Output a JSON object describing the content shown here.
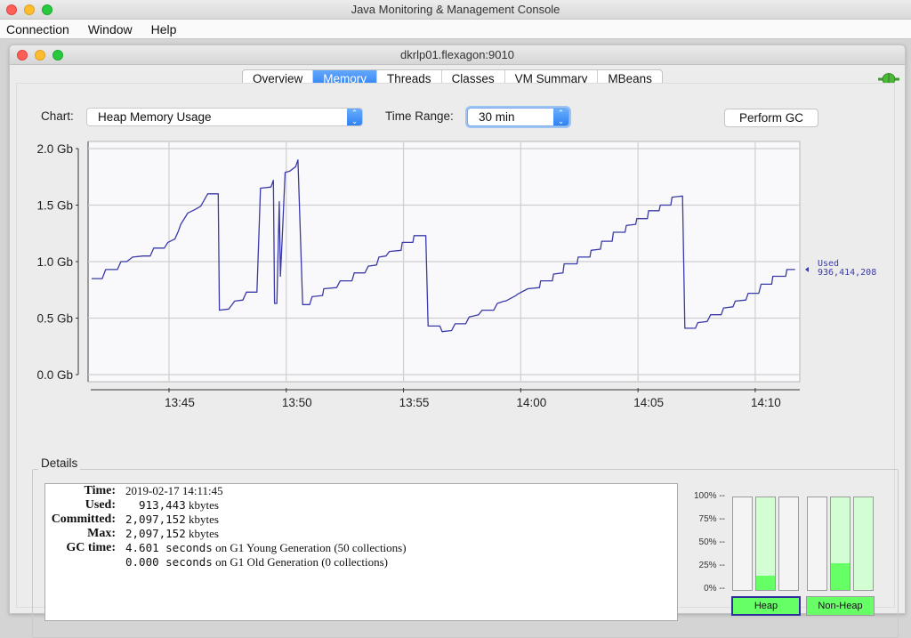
{
  "app": {
    "title": "Java Monitoring & Management Console",
    "menu": [
      "Connection",
      "Window",
      "Help"
    ]
  },
  "window": {
    "title": "dkrlp01.flexagon:9010",
    "tabs": [
      {
        "label": "Overview",
        "active": false
      },
      {
        "label": "Memory",
        "active": true
      },
      {
        "label": "Threads",
        "active": false
      },
      {
        "label": "Classes",
        "active": false
      },
      {
        "label": "VM Summary",
        "active": false
      },
      {
        "label": "MBeans",
        "active": false
      }
    ],
    "connection_icon": "connected-plug-icon"
  },
  "controls": {
    "chart_label": "Chart:",
    "chart_value": "Heap Memory Usage",
    "time_range_label": "Time Range:",
    "time_range_value": "30 min",
    "perform_gc_label": "Perform GC"
  },
  "chart_data": {
    "type": "line",
    "title": "Heap Memory Usage",
    "xlabel": "",
    "ylabel": "",
    "y_unit": "Gb",
    "ylim": [
      0,
      2.0
    ],
    "yticks": [
      {
        "value": 0.0,
        "label": "0.0 Gb"
      },
      {
        "value": 0.5,
        "label": "0.5 Gb"
      },
      {
        "value": 1.0,
        "label": "1.0 Gb"
      },
      {
        "value": 1.5,
        "label": "1.5 Gb"
      },
      {
        "value": 2.0,
        "label": "2.0 Gb"
      }
    ],
    "x_unit": "minutes since 13:00",
    "xlim": [
      41.7,
      71.9
    ],
    "xticks": [
      {
        "value": 45,
        "label": "13:45"
      },
      {
        "value": 50,
        "label": "13:50"
      },
      {
        "value": 55,
        "label": "13:55"
      },
      {
        "value": 60,
        "label": "14:00"
      },
      {
        "value": 65,
        "label": "14:05"
      },
      {
        "value": 70,
        "label": "14:10"
      }
    ],
    "grid": true,
    "line_color": "#3a3aa8",
    "series": [
      {
        "name": "Used",
        "points": [
          [
            41.7,
            0.85
          ],
          [
            42.15,
            0.85
          ],
          [
            42.3,
            0.93
          ],
          [
            42.8,
            0.93
          ],
          [
            42.95,
            1.0
          ],
          [
            43.2,
            1.0
          ],
          [
            43.45,
            1.04
          ],
          [
            43.9,
            1.05
          ],
          [
            44.2,
            1.05
          ],
          [
            44.35,
            1.12
          ],
          [
            44.8,
            1.12
          ],
          [
            44.95,
            1.17
          ],
          [
            45.25,
            1.2
          ],
          [
            45.4,
            1.27
          ],
          [
            45.5,
            1.33
          ],
          [
            45.8,
            1.43
          ],
          [
            46.1,
            1.46
          ],
          [
            46.35,
            1.49
          ],
          [
            46.65,
            1.6
          ],
          [
            47.1,
            1.6
          ],
          [
            47.15,
            0.57
          ],
          [
            47.55,
            0.58
          ],
          [
            47.8,
            0.65
          ],
          [
            48.15,
            0.66
          ],
          [
            48.3,
            0.73
          ],
          [
            48.75,
            0.73
          ],
          [
            48.9,
            1.65
          ],
          [
            49.35,
            1.66
          ],
          [
            49.45,
            1.72
          ],
          [
            49.5,
            0.63
          ],
          [
            49.6,
            0.63
          ],
          [
            49.7,
            1.53
          ],
          [
            49.75,
            0.87
          ],
          [
            49.85,
            1.31
          ],
          [
            49.95,
            1.79
          ],
          [
            50.15,
            1.8
          ],
          [
            50.4,
            1.84
          ],
          [
            50.5,
            1.9
          ],
          [
            50.7,
            0.62
          ],
          [
            51.0,
            0.62
          ],
          [
            51.1,
            0.69
          ],
          [
            51.55,
            0.7
          ],
          [
            51.6,
            0.76
          ],
          [
            52.15,
            0.77
          ],
          [
            52.3,
            0.83
          ],
          [
            52.8,
            0.83
          ],
          [
            52.9,
            0.9
          ],
          [
            53.35,
            0.9
          ],
          [
            53.5,
            0.96
          ],
          [
            53.85,
            0.97
          ],
          [
            53.95,
            1.04
          ],
          [
            54.25,
            1.05
          ],
          [
            54.4,
            1.09
          ],
          [
            54.9,
            1.1
          ],
          [
            54.95,
            1.17
          ],
          [
            55.4,
            1.17
          ],
          [
            55.45,
            1.23
          ],
          [
            55.95,
            1.23
          ],
          [
            56.05,
            0.43
          ],
          [
            56.55,
            0.43
          ],
          [
            56.65,
            0.38
          ],
          [
            57.05,
            0.39
          ],
          [
            57.2,
            0.45
          ],
          [
            57.65,
            0.45
          ],
          [
            57.8,
            0.51
          ],
          [
            58.2,
            0.53
          ],
          [
            58.35,
            0.57
          ],
          [
            58.85,
            0.57
          ],
          [
            59.0,
            0.63
          ],
          [
            59.3,
            0.65
          ],
          [
            59.35,
            0.65
          ],
          [
            59.8,
            0.7
          ],
          [
            59.85,
            0.71
          ],
          [
            60.3,
            0.76
          ],
          [
            60.8,
            0.77
          ],
          [
            60.85,
            0.83
          ],
          [
            61.35,
            0.83
          ],
          [
            61.4,
            0.89
          ],
          [
            61.8,
            0.9
          ],
          [
            61.85,
            0.98
          ],
          [
            62.4,
            0.98
          ],
          [
            62.45,
            1.04
          ],
          [
            62.95,
            1.04
          ],
          [
            63.0,
            1.1
          ],
          [
            63.4,
            1.11
          ],
          [
            63.45,
            1.18
          ],
          [
            63.9,
            1.18
          ],
          [
            63.95,
            1.26
          ],
          [
            64.45,
            1.26
          ],
          [
            64.5,
            1.32
          ],
          [
            64.9,
            1.33
          ],
          [
            64.95,
            1.38
          ],
          [
            65.4,
            1.38
          ],
          [
            65.45,
            1.45
          ],
          [
            65.9,
            1.45
          ],
          [
            65.95,
            1.5
          ],
          [
            66.4,
            1.5
          ],
          [
            66.45,
            1.57
          ],
          [
            66.9,
            1.58
          ],
          [
            67.0,
            0.41
          ],
          [
            67.45,
            0.41
          ],
          [
            67.55,
            0.46
          ],
          [
            67.95,
            0.47
          ],
          [
            68.1,
            0.53
          ],
          [
            68.55,
            0.53
          ],
          [
            68.65,
            0.59
          ],
          [
            69.05,
            0.6
          ],
          [
            69.15,
            0.65
          ],
          [
            69.6,
            0.66
          ],
          [
            69.7,
            0.72
          ],
          [
            70.15,
            0.72
          ],
          [
            70.25,
            0.8
          ],
          [
            70.7,
            0.8
          ],
          [
            70.75,
            0.87
          ],
          [
            71.3,
            0.87
          ],
          [
            71.35,
            0.93
          ],
          [
            71.7,
            0.93
          ]
        ]
      }
    ],
    "annotation": {
      "label": "Used",
      "value": "936,414,208",
      "marker": "left-pointing-triangle"
    }
  },
  "details": {
    "heading": "Details",
    "rows": [
      {
        "label": "Time:",
        "value": "2019-02-17 14:11:45",
        "mono": ""
      },
      {
        "label": "Used:",
        "mono": "  913,443",
        "value": " kbytes"
      },
      {
        "label": "Committed:",
        "mono": "2,097,152",
        "value": " kbytes"
      },
      {
        "label": "Max:",
        "mono": "2,097,152",
        "value": " kbytes"
      },
      {
        "label": "GC time:",
        "mono": "4.601 seconds",
        "value": " on G1 Young Generation (50 collections)"
      },
      {
        "label": "",
        "mono": "0.000 seconds",
        "value": " on G1 Old Generation (0 collections)"
      }
    ]
  },
  "memory_pools": {
    "scale_labels": [
      "100% --",
      "75% --",
      "50% --",
      "25% --",
      "0% --"
    ],
    "bars": [
      {
        "group": "Heap",
        "committed_pct": 0,
        "used_pct": 0
      },
      {
        "group": "Heap",
        "committed_pct": 100,
        "used_pct": 15
      },
      {
        "group": "Heap",
        "committed_pct": 0,
        "used_pct": 0
      },
      {
        "group": "Non-Heap",
        "committed_pct": 0,
        "used_pct": 0
      },
      {
        "group": "Non-Heap",
        "committed_pct": 100,
        "used_pct": 29
      },
      {
        "group": "Non-Heap",
        "committed_pct": 100,
        "used_pct": 0
      }
    ],
    "buttons": [
      {
        "label": "Heap",
        "selected": true
      },
      {
        "label": "Non-Heap",
        "selected": false
      }
    ],
    "used_color": "#66ff66",
    "committed_color": "#d3fdd3"
  }
}
